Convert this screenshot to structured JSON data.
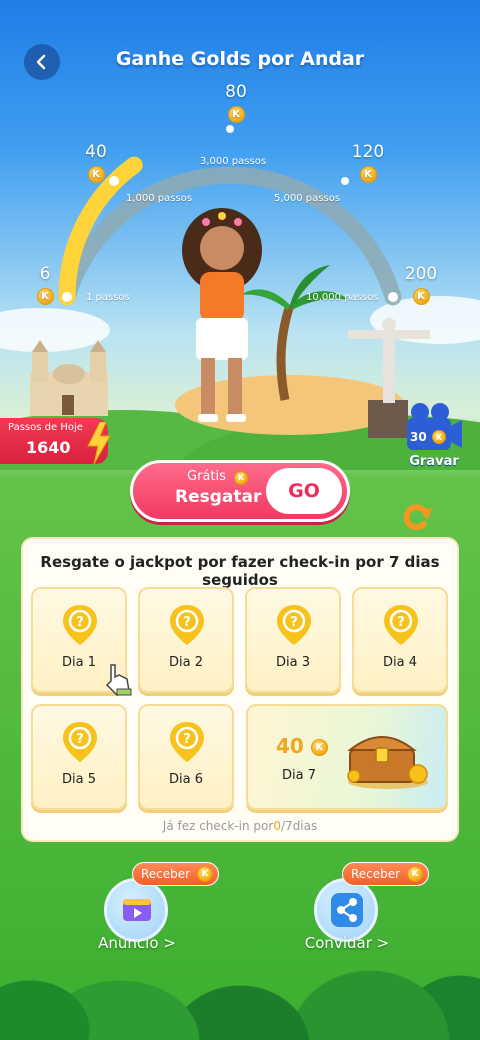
{
  "header": {
    "title": "Ganhe Golds por Andar"
  },
  "gauge": {
    "milestones": [
      {
        "reward": "6",
        "steps": "1 passos"
      },
      {
        "reward": "40",
        "steps": "1,000 passos"
      },
      {
        "reward": "80",
        "steps": "3,000 passos"
      },
      {
        "reward": "120",
        "steps": "5,000 passos"
      },
      {
        "reward": "200",
        "steps": "10,000 passos"
      }
    ],
    "coin_symbol": "K",
    "progress_fraction": 0.3
  },
  "today": {
    "label": "Passos de Hoje",
    "value": "1640"
  },
  "record": {
    "count": "30",
    "label": "Gravar"
  },
  "claim": {
    "free_label": "Grátis",
    "main_label": "Resgatar",
    "go_label": "GO"
  },
  "checkin": {
    "title": "Resgate o jackpot por fazer check-in por 7 dias seguidos",
    "days": [
      "Dia 1",
      "Dia 2",
      "Dia 3",
      "Dia 4",
      "Dia 5",
      "Dia 6"
    ],
    "day7": {
      "label": "Dia 7",
      "amount": "40"
    },
    "progress_prefix": "Já fez check-in por",
    "progress_count": "0",
    "progress_suffix": "/7dias"
  },
  "actions": [
    {
      "tag": "Receber",
      "label": "Anúncio >"
    },
    {
      "tag": "Receber",
      "label": "Convidar >"
    }
  ],
  "colors": {
    "accent": "#f03a64",
    "gold": "#f0a620",
    "sky": "#1f7de6"
  }
}
